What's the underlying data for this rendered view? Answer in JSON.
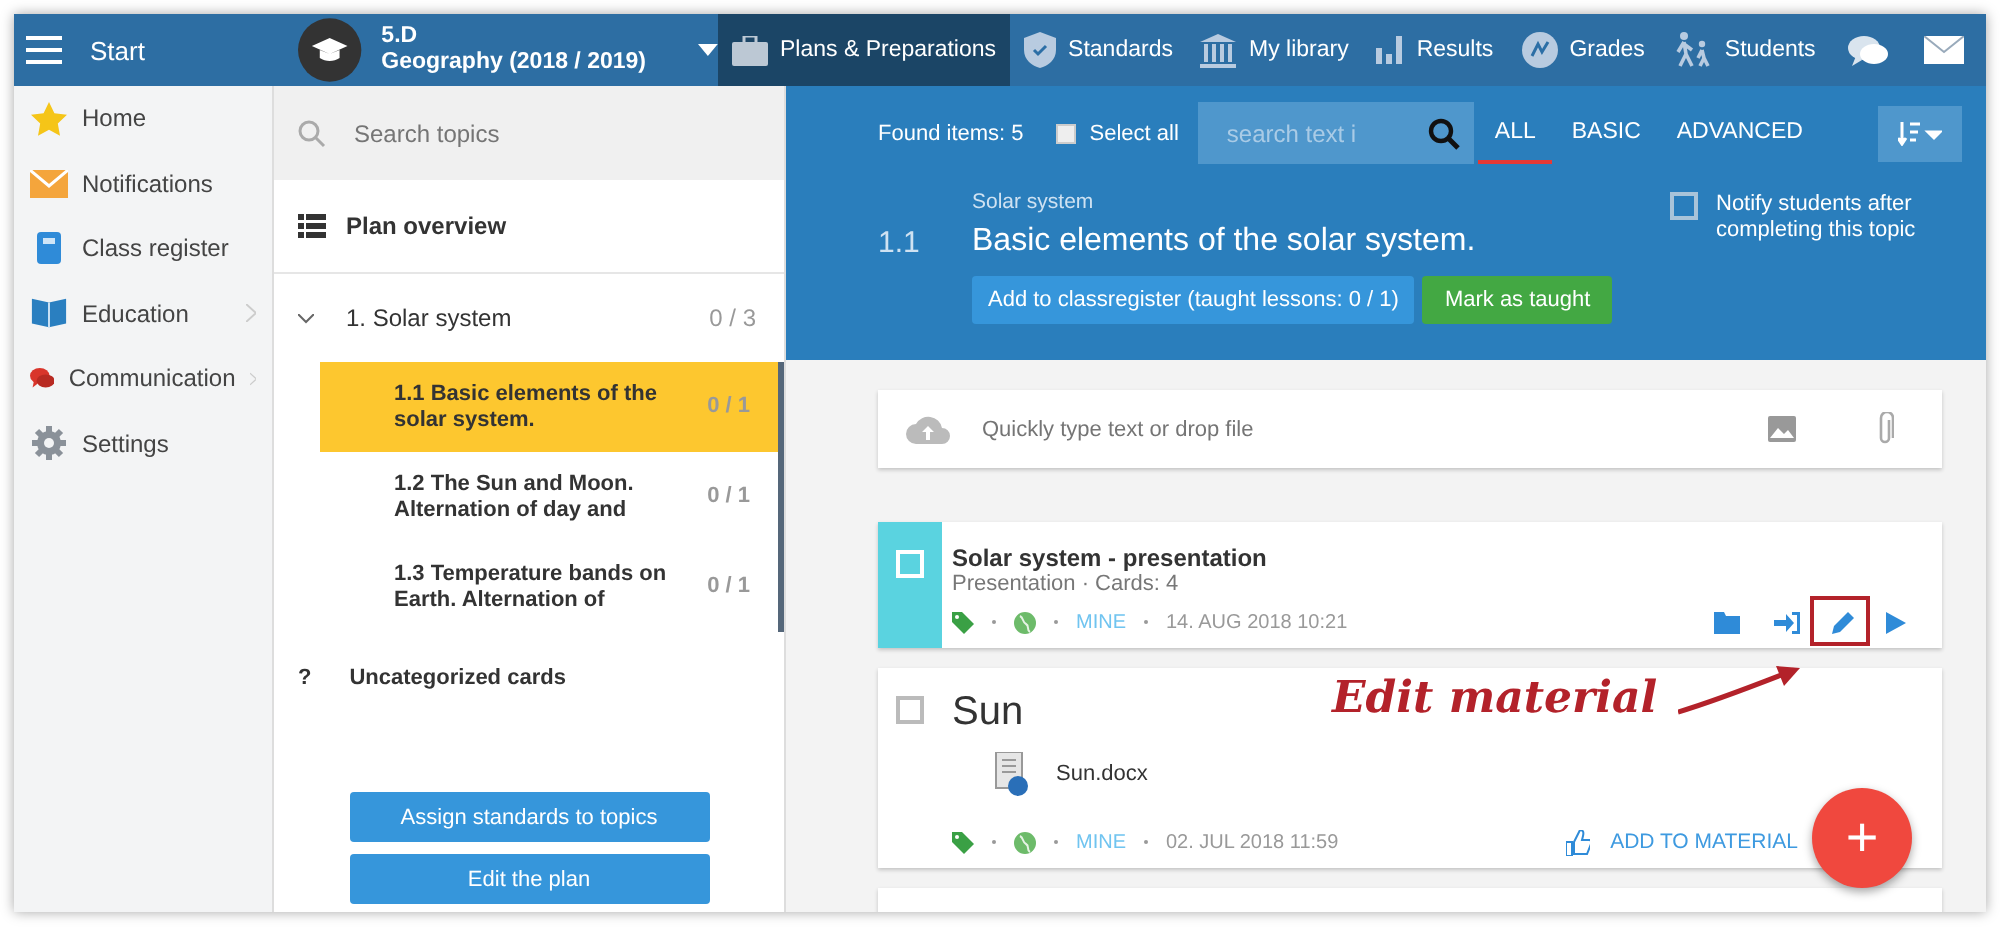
{
  "top_bar": {
    "menu_label": "Start",
    "class_name": "5.D",
    "subject": "Geography (2018 / 2019)",
    "nav": [
      {
        "label": "Plans & Preparations",
        "selected": true
      },
      {
        "label": "Standards",
        "selected": false
      },
      {
        "label": "My library",
        "selected": false
      },
      {
        "label": "Results",
        "selected": false
      },
      {
        "label": "Grades",
        "selected": false
      },
      {
        "label": "Students",
        "selected": false
      }
    ]
  },
  "sidebar": {
    "items": [
      {
        "label": "Home",
        "has_submenu": false
      },
      {
        "label": "Notifications",
        "has_submenu": false
      },
      {
        "label": "Class register",
        "has_submenu": false
      },
      {
        "label": "Education",
        "has_submenu": true
      },
      {
        "label": "Communication",
        "has_submenu": true
      },
      {
        "label": "Settings",
        "has_submenu": false
      }
    ]
  },
  "topics": {
    "search_placeholder": "Search topics",
    "overview": "Plan overview",
    "tree": [
      {
        "label": "1. Solar system",
        "count": "0 / 3",
        "expanded": true,
        "children": [
          {
            "label": "1.1 Basic elements of the solar system.",
            "count": "0 / 1",
            "selected": true
          },
          {
            "label": "1.2 The Sun and Moon. Alternation of day and",
            "count": "0 / 1",
            "selected": false
          },
          {
            "label": "1.3 Temperature bands on Earth. Alternation of",
            "count": "0 / 1",
            "selected": false
          }
        ]
      }
    ],
    "uncategorized_mark": "?",
    "uncategorized": "Uncategorized cards",
    "buttons": [
      "Assign standards to topics",
      "Edit the plan"
    ]
  },
  "toolbar": {
    "found": "Found items: 5",
    "select_all": {
      "label": "Select all",
      "checked": false
    },
    "search_placeholder": "search text i",
    "filters": [
      {
        "label": "ALL",
        "selected": true
      },
      {
        "label": "BASIC",
        "selected": false
      },
      {
        "label": "ADVANCED",
        "selected": false
      }
    ]
  },
  "topic_header": {
    "parent": "Solar system",
    "number": "1.1",
    "title": "Basic elements of the solar system.",
    "add_button": "Add to classregister (taught lessons: 0 / 1)",
    "taught_button": "Mark as taught",
    "notify": {
      "label": "Notify students after completing this topic",
      "checked": false
    }
  },
  "composer": {
    "placeholder": "Quickly type text or drop file"
  },
  "cards": [
    {
      "kind": "presentation",
      "highlighted": true,
      "checked": false,
      "title": "Solar system - presentation",
      "subtitle": "Presentation · Cards: 4",
      "owner": "MINE",
      "date": "14. AUG 2018 10:21"
    },
    {
      "kind": "file",
      "highlighted": false,
      "checked": false,
      "title": "Sun",
      "file": "Sun.docx",
      "owner": "MINE",
      "date": "02. JUL 2018 11:59",
      "action": "ADD TO MATERIAL"
    }
  ],
  "annotation": {
    "text": "Edit material"
  },
  "fab": {
    "label": "+"
  }
}
